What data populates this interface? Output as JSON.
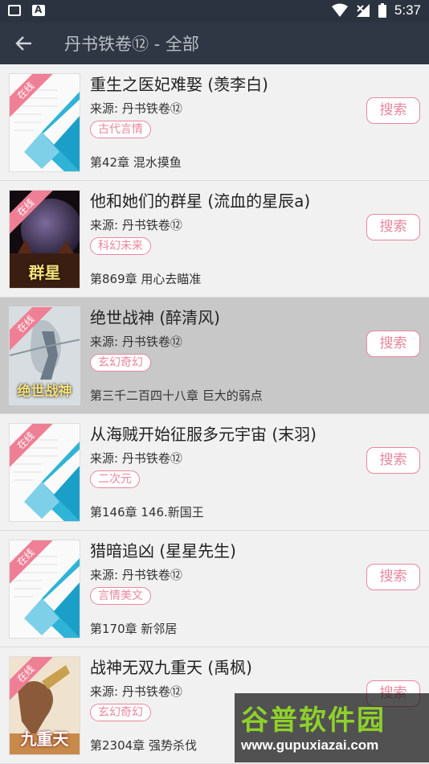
{
  "status": {
    "time": "5:37"
  },
  "header": {
    "title": "丹书铁卷⑫ - 全部"
  },
  "labels": {
    "online": "在线",
    "search": "搜索"
  },
  "books": [
    {
      "name": "重生之医妃难娶 (羡李白)",
      "source": "来源: 丹书铁卷⑫",
      "tag": "古代言情",
      "chapter": "第42章 混水摸鱼",
      "cover": "default"
    },
    {
      "name": "他和她们的群星 (流血的星辰a)",
      "source": "来源: 丹书铁卷⑫",
      "tag": "科幻未来",
      "chapter": "第869章 用心去瞄准",
      "cover": "space",
      "cover_text": "群星"
    },
    {
      "name": "绝世战神 (醉清风)",
      "source": "来源: 丹书铁卷⑫",
      "tag": "玄幻奇幻",
      "chapter": "第三千二百四十八章 巨大的弱点",
      "cover": "warrior",
      "cover_text": "绝世战神"
    },
    {
      "name": "从海贼开始征服多元宇宙 (末羽)",
      "source": "来源: 丹书铁卷⑫",
      "tag": "二次元",
      "chapter": "第146章 146.新国王",
      "cover": "default"
    },
    {
      "name": "猎暗追凶 (星星先生)",
      "source": "来源: 丹书铁卷⑫",
      "tag": "言情美文",
      "chapter": "第170章 新邻居",
      "cover": "default"
    },
    {
      "name": "战神无双九重天 (禹枫)",
      "source": "来源: 丹书铁卷⑫",
      "tag": "玄幻奇幻",
      "chapter": "第2304章 强势杀伐",
      "cover": "fighter",
      "cover_text": "九重天"
    }
  ],
  "watermark": {
    "text": "谷普软件园",
    "url": "www.gupuxiazai.com"
  }
}
